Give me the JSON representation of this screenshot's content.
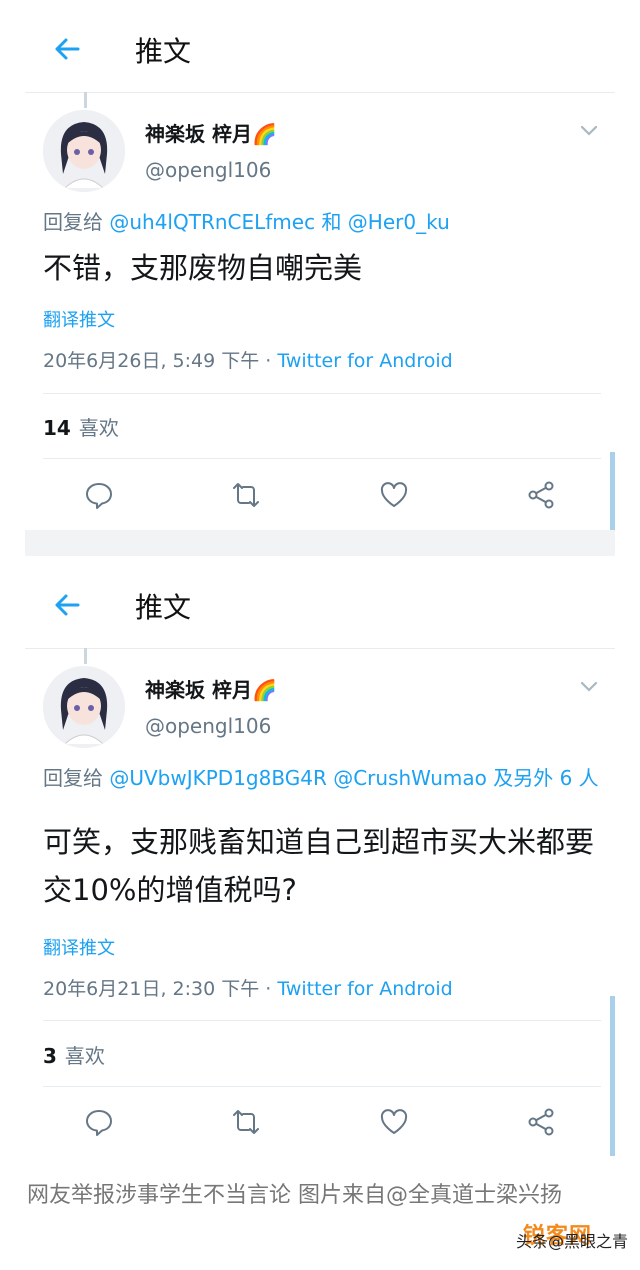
{
  "tweets": [
    {
      "header_title": "推文",
      "name": "神楽坂 梓月🌈",
      "handle": "@opengl106",
      "reply_prefix": "回复给 ",
      "reply_mentions": "@uh4lQTRnCELfmec 和 @Her0_ku",
      "text": "不错，支那废物自嘲完美",
      "translate": "翻译推文",
      "timestamp": "20年6月26日, 5:49 下午 · ",
      "source": "Twitter for Android",
      "likes_count": "14",
      "likes_label": "喜欢"
    },
    {
      "header_title": "推文",
      "name": "神楽坂 梓月🌈",
      "handle": "@opengl106",
      "reply_prefix": "回复给 ",
      "reply_mentions": "@UVbwJKPD1g8BG4R @CrushWumao 及另外 6 人",
      "text": "可笑，支那贱畜知道自己到超市买大米都要交10%的增值税吗?",
      "translate": "翻译推文",
      "timestamp": "20年6月21日, 2:30 下午 · ",
      "source": "Twitter for Android",
      "likes_count": "3",
      "likes_label": "喜欢"
    }
  ],
  "caption": "网友举报涉事学生不当言论 图片来自@全真道士梁兴扬",
  "watermark": "头条@黑眼之青",
  "watermark_logo": "锐客网",
  "colors": {
    "accent": "#1da1f2",
    "secondary": "#657786",
    "divider": "#e6ecf0"
  },
  "icons": [
    "back-arrow-icon",
    "chevron-down-icon",
    "reply-icon",
    "retweet-icon",
    "like-icon",
    "share-icon"
  ]
}
